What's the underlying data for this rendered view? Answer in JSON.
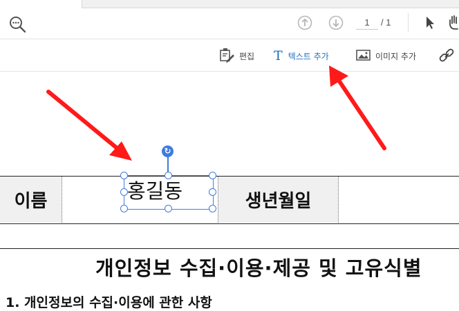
{
  "toolbar": {
    "page_current": "1",
    "page_total_label": "/ 1"
  },
  "edit_tools": {
    "edit_label": "편집",
    "add_text_label": "텍스트 추가",
    "add_image_label": "이미지 추가"
  },
  "document": {
    "row_label_name": "이름",
    "name_value": "홍길동",
    "row_label_birth": "생년월일",
    "title": "개인정보 수집·이용·제공 및 고유식별",
    "section_1": "1. 개인정보의 수집·이용에 관한 사항"
  },
  "colors": {
    "accent_blue": "#1f6fc1",
    "selection_blue": "#3d7be0",
    "annotation_red": "#ff1a1a"
  }
}
